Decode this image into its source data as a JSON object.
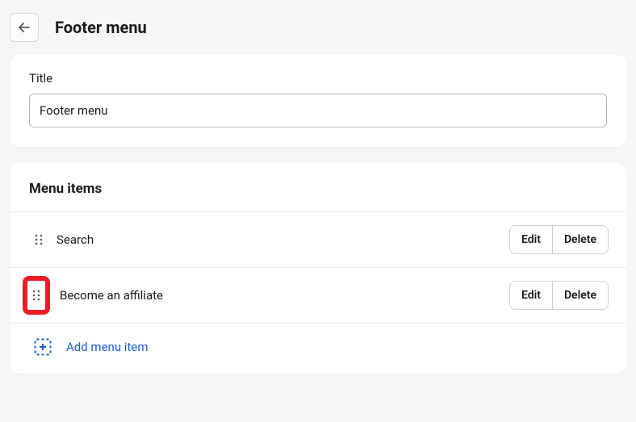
{
  "header": {
    "title": "Footer menu"
  },
  "titleCard": {
    "label": "Title",
    "value": "Footer menu"
  },
  "menuSection": {
    "heading": "Menu items",
    "items": [
      {
        "label": "Search",
        "highlighted": false
      },
      {
        "label": "Become an affiliate",
        "highlighted": true
      }
    ],
    "editLabel": "Edit",
    "deleteLabel": "Delete",
    "addLabel": "Add menu item"
  }
}
